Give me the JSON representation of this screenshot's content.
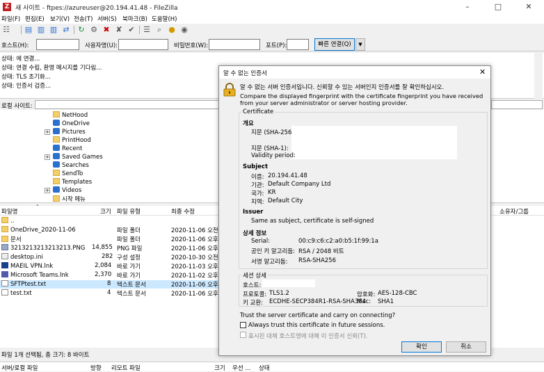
{
  "window": {
    "title": "새 사이트 - ftpes://azureuser@20.194.41.48 - FileZilla",
    "app_icon": "Z"
  },
  "menu": [
    "파일(F)",
    "편집(E)",
    "보기(V)",
    "전송(T)",
    "서버(S)",
    "북마크(B)",
    "도움말(H)"
  ],
  "quickconnect": {
    "host_label": "호스트(H):",
    "user_label": "사용자명(U):",
    "pass_label": "비밀번호(W):",
    "port_label": "포트(P):",
    "connect_button": "빠른 연결(Q)"
  },
  "log": [
    "상태:          에 연결...",
    "상태: 연결 수립, 환영 메시지를 기다림...",
    "상태: TLS 초기화...",
    "상태: 인증서 검증..."
  ],
  "local_site_label": "로컬 사이트:",
  "tree": [
    "NetHood",
    "OneDrive",
    "Pictures",
    "PrintHood",
    "Recent",
    "Saved Games",
    "Searches",
    "SendTo",
    "Templates",
    "Videos",
    "시작 메뉴"
  ],
  "file_columns": {
    "name": "파일명",
    "size": "크기",
    "type": "파일 유형",
    "modified": "최종 수정"
  },
  "remote_column_owner": "소유자/그룹",
  "files": [
    {
      "name": "..",
      "size": "",
      "type": "",
      "modified": ""
    },
    {
      "name": "OneDrive_2020-11-06",
      "size": "",
      "type": "파일 폴더",
      "modified": "2020-11-06 오전 ..."
    },
    {
      "name": "문서",
      "size": "",
      "type": "파일 폴더",
      "modified": "2020-11-06 오후 ..."
    },
    {
      "name": "3213213213213213.PNG",
      "size": "14,855",
      "type": "PNG 파일",
      "modified": "2020-11-06 오후 ..."
    },
    {
      "name": "desktop.ini",
      "size": "282",
      "type": "구성 설정",
      "modified": "2020-10-30 오전 ..."
    },
    {
      "name": "MAEIL VPN.lnk",
      "size": "2,084",
      "type": "바로 가기",
      "modified": "2020-11-03 오후 ..."
    },
    {
      "name": "Microsoft Teams.lnk",
      "size": "2,370",
      "type": "바로 가기",
      "modified": "2020-11-02 오후 ..."
    },
    {
      "name": "SFTPtest.txt",
      "size": "8",
      "type": "텍스트 문서",
      "modified": "2020-11-06 오후 ..."
    },
    {
      "name": "test.txt",
      "size": "4",
      "type": "텍스트 문서",
      "modified": "2020-11-06 오후 ..."
    }
  ],
  "local_status": "파일 1개 선택됨, 총 크기: 8 바이트",
  "queue_columns": {
    "server_local": "서버/로컬 파일",
    "direction": "방향",
    "remote": "리모트 파일",
    "size": "크기",
    "priority": "우선 ...",
    "status": "상태"
  },
  "dialog": {
    "title": "알 수 없는 인증서",
    "heading": "알 수 없는 서버 인증서입니다. 신뢰할 수 있는 서버인지 인증서를 잘 확인하십시오.",
    "description": "Compare the displayed fingerprint with the certificate fingerprint you have received from your server administrator or server hosting provider.",
    "certificate_group": "Certificate",
    "overview_heading": "개요",
    "fp256_label": "지문 (SHA-256):",
    "fp1_label": "지문 (SHA-1):",
    "validity_label": "Validity period:",
    "subject_heading": "Subject",
    "subject": [
      {
        "label": "이름:",
        "value": "20.194.41.48"
      },
      {
        "label": "기관:",
        "value": "Default Company Ltd"
      },
      {
        "label": "국가:",
        "value": "KR"
      },
      {
        "label": "지역:",
        "value": "Default City"
      }
    ],
    "issuer_heading": "Issuer",
    "issuer_text": "Same as subject, certificate is self-signed",
    "details_heading": "상세 정보",
    "details": [
      {
        "label": "Serial:",
        "value": "00:c9:c6:c2:a0:b5:1f:99:1a"
      },
      {
        "label": "공인 키 알고리듬:",
        "value": "RSA / 2048 비트"
      },
      {
        "label": "서명 알고리듬:",
        "value": "RSA-SHA256"
      }
    ],
    "session_group": "세션 상세",
    "host_label": "호스트:",
    "protocol_label": "프로토콜:",
    "protocol_value": "TLS1.2",
    "cipher_label": "암호화:",
    "cipher_value": "AES-128-CBC",
    "kex_label": "키 교환:",
    "kex_value": "ECDHE-SECP384R1-RSA-SHA384",
    "mac_label": "Mac:",
    "mac_value": "SHA1",
    "trust_question": "Trust the server certificate and carry on connecting?",
    "always_trust": "Always trust this certificate in future sessions.",
    "trust_alt": "표시된 대체 호스트명에 대해 이 인증서 신뢰(T).",
    "ok_button": "확인",
    "cancel_button": "취소"
  }
}
